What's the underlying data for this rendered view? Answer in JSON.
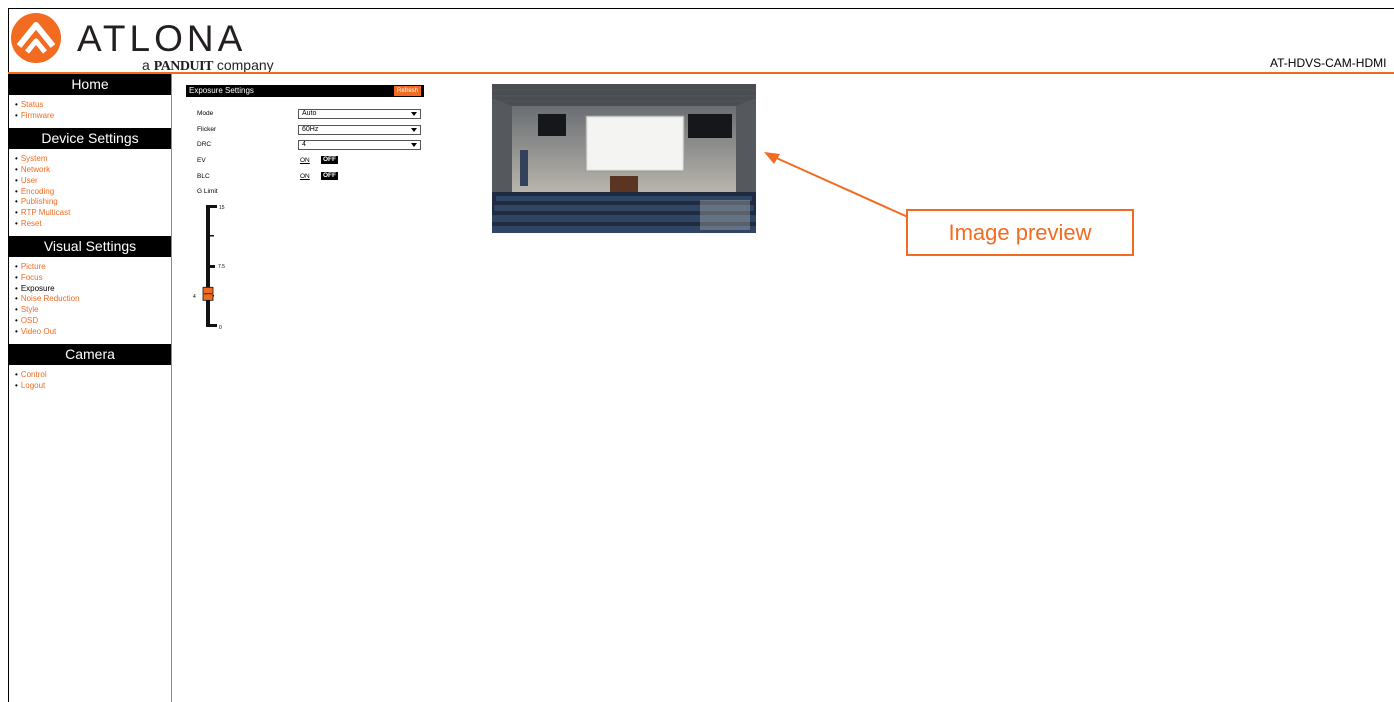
{
  "brand": {
    "name": "ATLONA",
    "tagline_prefix": "a",
    "tagline_brand": "PANDUIT",
    "tagline_suffix": "company",
    "accent_color": "#f26b21"
  },
  "model": "AT-HDVS-CAM-HDMI",
  "sidebar": {
    "sections": [
      {
        "title": "Home",
        "items": [
          {
            "label": "Status"
          },
          {
            "label": "Firmware"
          }
        ]
      },
      {
        "title": "Device Settings",
        "items": [
          {
            "label": "System"
          },
          {
            "label": "Network"
          },
          {
            "label": "User"
          },
          {
            "label": "Encoding"
          },
          {
            "label": "Publishing"
          },
          {
            "label": "RTP Multicast"
          },
          {
            "label": "Reset"
          }
        ]
      },
      {
        "title": "Visual Settings",
        "items": [
          {
            "label": "Picture"
          },
          {
            "label": "Focus"
          },
          {
            "label": "Exposure",
            "active": true
          },
          {
            "label": "Noise Reduction"
          },
          {
            "label": "Style"
          },
          {
            "label": "OSD"
          },
          {
            "label": "Video Out"
          }
        ]
      },
      {
        "title": "Camera",
        "items": [
          {
            "label": "Control"
          },
          {
            "label": "Logout"
          }
        ]
      }
    ]
  },
  "exposure": {
    "title": "Exposure Settings",
    "refresh_label": "Refresh",
    "mode": {
      "label": "Mode",
      "value": "Auto"
    },
    "flicker": {
      "label": "Flicker",
      "value": "60Hz"
    },
    "drc": {
      "label": "DRC",
      "value": "4"
    },
    "ev": {
      "label": "EV",
      "on_label": "ON",
      "off_label": "OFF"
    },
    "blc": {
      "label": "BLC",
      "on_label": "ON",
      "off_label": "OFF"
    },
    "glimit": {
      "label": "G Limit",
      "max": "15",
      "mid": "7.5",
      "min": "0",
      "value": "4"
    }
  },
  "annotation": {
    "label": "Image preview"
  }
}
